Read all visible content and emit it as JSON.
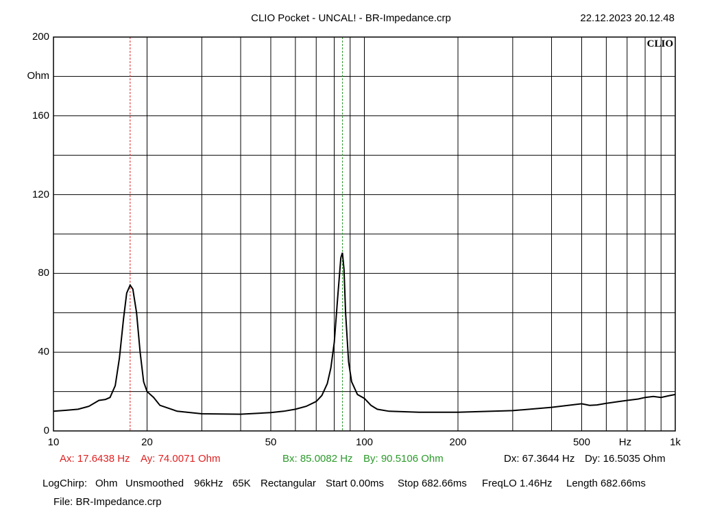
{
  "header": {
    "title": "CLIO Pocket - UNCAL! - BR-Impedance.crp",
    "datetime": "22.12.2023 20.12.48",
    "logo": "CLIO"
  },
  "chart_data": {
    "type": "line",
    "x_scale": "log",
    "xlim": [
      10,
      1000
    ],
    "ylim": [
      0,
      200
    ],
    "ylabel": "Ohm",
    "xlabel": "Hz",
    "x_ticks": [
      10,
      20,
      50,
      100,
      200,
      500,
      1000
    ],
    "x_tick_labels": [
      "10",
      "20",
      "50",
      "100",
      "200",
      "500",
      "1k"
    ],
    "y_ticks": [
      0,
      40,
      80,
      120,
      160,
      200
    ],
    "y_tick_labels": [
      "0",
      "40",
      "80",
      "120",
      "160",
      "200"
    ],
    "grid": true,
    "series": [
      {
        "color": "#000000",
        "x": [
          10,
          11,
          12,
          13,
          14,
          14.7,
          15.2,
          15.8,
          16.3,
          16.8,
          17.2,
          17.64,
          18.0,
          18.5,
          19.0,
          19.5,
          20,
          21,
          22,
          25,
          30,
          40,
          50,
          55,
          60,
          65,
          70,
          73,
          76,
          78,
          80,
          82,
          84,
          85,
          86,
          87,
          89,
          91,
          95,
          100,
          105,
          110,
          120,
          150,
          200,
          300,
          400,
          500,
          530,
          560,
          600,
          650,
          700,
          760,
          800,
          850,
          900,
          950,
          1000
        ],
        "y": [
          10,
          10.5,
          11,
          12.5,
          15.5,
          16,
          17,
          23,
          37,
          57,
          70,
          74,
          72,
          60,
          40,
          25,
          20,
          17,
          13,
          10,
          8.7,
          8.5,
          9.3,
          10,
          11,
          12.5,
          15,
          18,
          24,
          32,
          45,
          67,
          88,
          90.5,
          82,
          60,
          35,
          25,
          18.5,
          16.5,
          13,
          11,
          10,
          9.5,
          9.5,
          10.3,
          12,
          13.8,
          13,
          13.2,
          14,
          14.8,
          15.5,
          16.2,
          17,
          17.5,
          17,
          17.8,
          18.5
        ]
      }
    ],
    "markers": [
      {
        "name": "A",
        "x": 17.6438,
        "color": "#e02020",
        "style": "dashed"
      },
      {
        "name": "B",
        "x": 85.0082,
        "color": "#2a9a2a",
        "style": "dashed"
      }
    ]
  },
  "readouts": {
    "ax": "Ax: 17.6438 Hz",
    "ay": "Ay: 74.0071 Ohm",
    "bx": "Bx: 85.0082 Hz",
    "by": "By: 90.5106 Ohm",
    "dx": "Dx: 67.3644 Hz",
    "dy": "Dy: 16.5035 Ohm"
  },
  "settings": {
    "mode": "LogChirp:",
    "unit": "Ohm",
    "smoothing": "Unsmoothed",
    "rate": "96kHz",
    "size": "65K",
    "window": "Rectangular",
    "start": "Start 0.00ms",
    "stop": "Stop 682.66ms",
    "freqlo": "FreqLO 1.46Hz",
    "length": "Length 682.66ms"
  },
  "file": {
    "label": "File: BR-Impedance.crp"
  }
}
